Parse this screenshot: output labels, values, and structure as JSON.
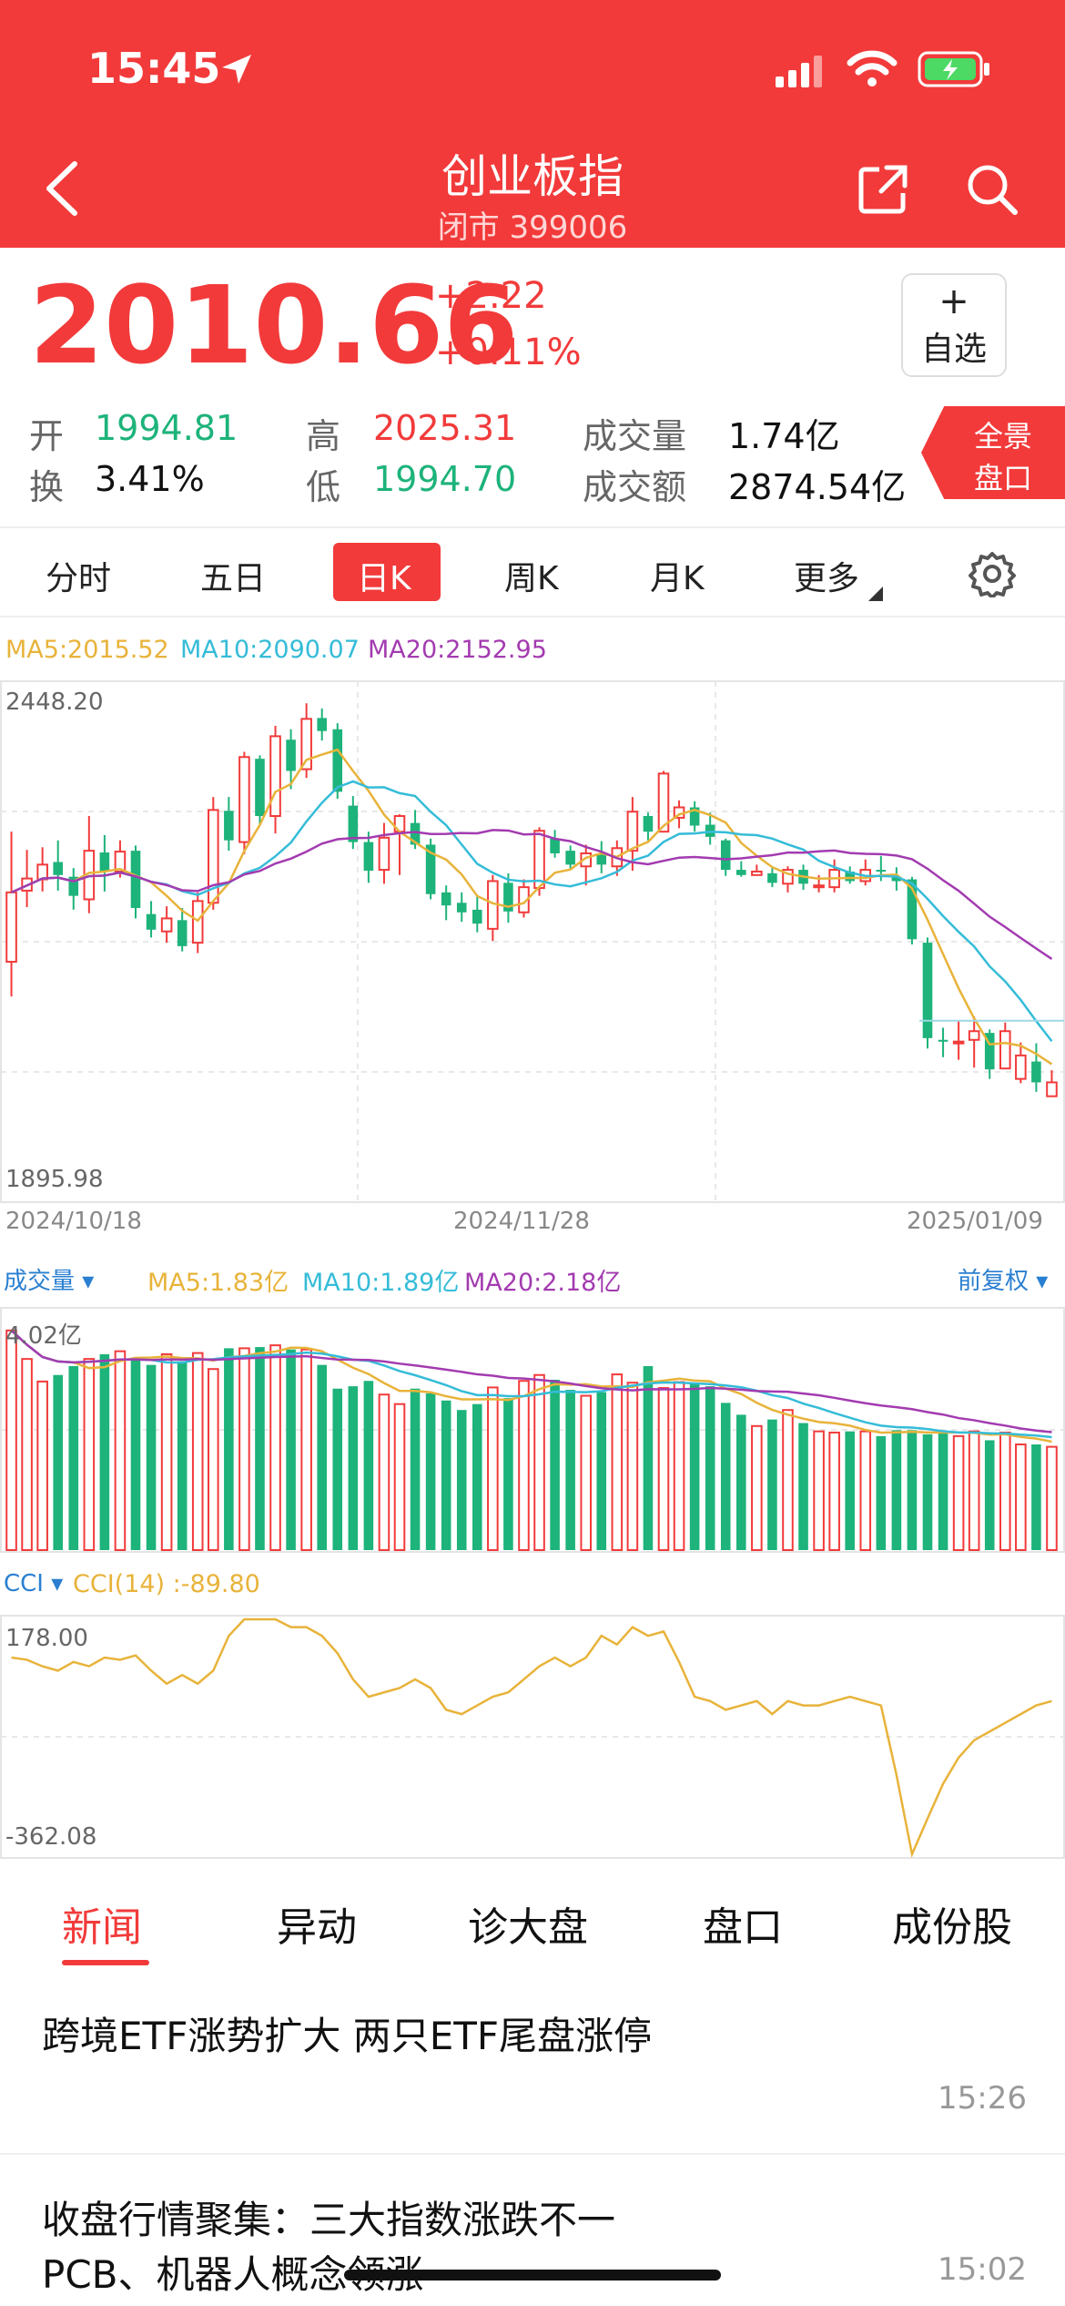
{
  "status_bar": {
    "time": "15:45"
  },
  "header": {
    "title": "创业板指",
    "subtitle": "闭市 399006"
  },
  "quote": {
    "price": "2010.66",
    "change": "+2.22",
    "change_pct": "+0.11%",
    "add_watch_plus": "+",
    "add_watch_label": "自选",
    "open_label": "开",
    "open": "1994.81",
    "high_label": "高",
    "high": "2025.31",
    "turnover_label": "换",
    "turnover": "3.41%",
    "low_label": "低",
    "low": "1994.70",
    "volume_label": "成交量",
    "volume": "1.74亿",
    "amount_label": "成交额",
    "amount": "2874.54亿",
    "panorama_line1": "全景",
    "panorama_line2": "盘口"
  },
  "period_tabs": {
    "items": [
      "分时",
      "五日",
      "日K",
      "周K",
      "月K",
      "更多"
    ],
    "active": 2
  },
  "kline": {
    "ma5": "MA5:2015.52",
    "ma10": "MA10:2090.07",
    "ma20": "MA20:2152.95",
    "y_max_label": "2448.20",
    "y_min_label": "1895.98",
    "date_start": "2024/10/18",
    "date_mid": "2024/11/28",
    "date_end": "2025/01/09"
  },
  "volume_panel": {
    "label": "成交量",
    "ma5": "MA5:1.83亿",
    "ma10": "MA10:1.89亿",
    "ma20": "MA20:2.18亿",
    "adjust_label": "前复权",
    "y_max_label": "4.02亿"
  },
  "cci_panel": {
    "label": "CCI",
    "value": "CCI(14) :-89.80",
    "y_max_label": "178.00",
    "y_min_label": "-362.08"
  },
  "news_tabs": {
    "items": [
      "新闻",
      "异动",
      "诊大盘",
      "盘口",
      "成份股"
    ],
    "active": 0
  },
  "news": [
    {
      "title": "跨境ETF涨势扩大 两只ETF尾盘涨停",
      "time": "15:26"
    },
    {
      "title": "收盘行情聚集：三大指数涨跌不一 PCB、机器人概念领涨",
      "time": "15:02"
    }
  ],
  "colors": {
    "brand": "#f23a3a",
    "up": "#f23a3a",
    "down": "#1db37a",
    "ma5": "#e8b33a",
    "ma10": "#35bcd8",
    "ma20": "#a33bb0"
  },
  "chart_data": [
    {
      "type": "candlestick",
      "title": "日K",
      "ylim": [
        1895.98,
        2448.2
      ],
      "x_tick_labels": [
        "2024/10/18",
        "2024/11/28",
        "2025/01/09"
      ],
      "candles": [
        [
          2150,
          2230,
          2300,
          2110
        ],
        [
          2232,
          2246,
          2279,
          2213
        ],
        [
          2245,
          2262,
          2282,
          2231
        ],
        [
          2265,
          2250,
          2290,
          2232
        ],
        [
          2248,
          2226,
          2258,
          2210
        ],
        [
          2222,
          2278,
          2318,
          2206
        ],
        [
          2276,
          2254,
          2296,
          2231
        ],
        [
          2254,
          2277,
          2290,
          2247
        ],
        [
          2278,
          2212,
          2284,
          2200
        ],
        [
          2205,
          2187,
          2220,
          2178
        ],
        [
          2185,
          2200,
          2214,
          2172
        ],
        [
          2198,
          2168,
          2212,
          2162
        ],
        [
          2172,
          2220,
          2230,
          2160
        ],
        [
          2218,
          2325,
          2340,
          2210
        ],
        [
          2324,
          2290,
          2340,
          2278
        ],
        [
          2288,
          2386,
          2392,
          2274
        ],
        [
          2384,
          2318,
          2388,
          2308
        ],
        [
          2318,
          2410,
          2422,
          2298
        ],
        [
          2406,
          2370,
          2418,
          2349
        ],
        [
          2372,
          2430,
          2448,
          2362
        ],
        [
          2431,
          2416,
          2442,
          2405
        ],
        [
          2418,
          2346,
          2425,
          2338
        ],
        [
          2330,
          2288,
          2341,
          2280
        ],
        [
          2288,
          2255,
          2300,
          2241
        ],
        [
          2256,
          2293,
          2310,
          2240
        ],
        [
          2300,
          2318,
          2320,
          2250
        ],
        [
          2310,
          2285,
          2325,
          2280
        ],
        [
          2285,
          2228,
          2292,
          2222
        ],
        [
          2230,
          2215,
          2238,
          2198
        ],
        [
          2218,
          2207,
          2230,
          2196
        ],
        [
          2210,
          2194,
          2225,
          2184
        ],
        [
          2188,
          2243,
          2250,
          2174
        ],
        [
          2241,
          2208,
          2252,
          2195
        ],
        [
          2207,
          2236,
          2245,
          2201
        ],
        [
          2235,
          2301,
          2305,
          2226
        ],
        [
          2292,
          2275,
          2302,
          2270
        ],
        [
          2278,
          2262,
          2284,
          2256
        ],
        [
          2260,
          2275,
          2285,
          2238
        ],
        [
          2275,
          2262,
          2289,
          2252
        ],
        [
          2260,
          2281,
          2290,
          2249
        ],
        [
          2278,
          2323,
          2340,
          2255
        ],
        [
          2318,
          2300,
          2322,
          2290
        ],
        [
          2300,
          2367,
          2370,
          2300
        ],
        [
          2316,
          2328,
          2336,
          2304
        ],
        [
          2328,
          2307,
          2335,
          2300
        ],
        [
          2308,
          2294,
          2322,
          2285
        ],
        [
          2290,
          2256,
          2292,
          2249
        ],
        [
          2256,
          2250,
          2266,
          2248
        ],
        [
          2250,
          2254,
          2262,
          2250
        ],
        [
          2252,
          2241,
          2258,
          2236
        ],
        [
          2240,
          2256,
          2260,
          2230
        ],
        [
          2256,
          2240,
          2262,
          2233
        ],
        [
          2238,
          2238,
          2250,
          2230
        ],
        [
          2236,
          2256,
          2268,
          2230
        ],
        [
          2254,
          2243,
          2260,
          2240
        ],
        [
          2243,
          2256,
          2268,
          2238
        ],
        [
          2256,
          2255,
          2272,
          2243
        ],
        [
          2248,
          2243,
          2259,
          2232
        ],
        [
          2245,
          2176,
          2248,
          2170
        ],
        [
          2172,
          2062,
          2178,
          2050
        ],
        [
          2060,
          2058,
          2074,
          2040
        ],
        [
          2058,
          2058,
          2082,
          2037
        ],
        [
          2060,
          2070,
          2087,
          2028
        ],
        [
          2068,
          2026,
          2072,
          2015
        ],
        [
          2027,
          2070,
          2080,
          2026
        ],
        [
          2015,
          2042,
          2057,
          2010
        ],
        [
          2035,
          2011,
          2056,
          2000
        ],
        [
          1995,
          2011,
          2025,
          1995
        ]
      ],
      "ma5_label": "MA5:2015.52",
      "ma10_label": "MA10:2090.07",
      "ma20_label": "MA20:2152.95"
    },
    {
      "type": "bar",
      "title": "成交量",
      "ylim": [
        0,
        4.02
      ],
      "values": [
        3.7,
        3.22,
        2.84,
        2.95,
        3.1,
        3.22,
        3.3,
        3.35,
        3.23,
        3.12,
        3.3,
        3.18,
        3.32,
        3.05,
        3.4,
        3.4,
        3.42,
        3.45,
        3.38,
        3.38,
        3.12,
        2.72,
        2.76,
        2.85,
        2.62,
        2.46,
        2.72,
        2.64,
        2.52,
        2.36,
        2.46,
        2.74,
        2.56,
        2.85,
        2.95,
        2.87,
        2.7,
        2.6,
        2.66,
        2.96,
        2.82,
        3.1,
        2.73,
        2.83,
        2.8,
        2.76,
        2.48,
        2.28,
        2.09,
        2.2,
        2.36,
        2.14,
        2.0,
        1.98,
        2.0,
        2.0,
        1.92,
        2.02,
        2.02,
        1.95,
        2.0,
        1.92,
        2.0,
        1.85,
        1.98,
        1.78,
        1.78,
        1.74
      ],
      "ma5_label": "MA5:1.83亿",
      "ma10_label": "MA10:1.89亿",
      "ma20_label": "MA20:2.18亿"
    },
    {
      "type": "line",
      "title": "CCI(14)",
      "ylim": [
        -362.08,
        178.0
      ],
      "series": [
        {
          "name": "CCI(14)",
          "values": [
            90,
            85,
            70,
            60,
            80,
            70,
            90,
            85,
            95,
            60,
            30,
            50,
            30,
            60,
            140,
            178,
            178,
            178,
            160,
            160,
            140,
            100,
            40,
            0,
            10,
            20,
            40,
            20,
            -30,
            -40,
            -20,
            0,
            10,
            40,
            70,
            90,
            70,
            90,
            140,
            120,
            160,
            140,
            150,
            80,
            0,
            -10,
            -30,
            -20,
            -10,
            -40,
            -10,
            -20,
            -20,
            -10,
            0,
            -10,
            -20,
            -180,
            -362,
            -280,
            -200,
            -140,
            -100,
            -80,
            -60,
            -40,
            -20,
            -10
          ]
        }
      ]
    }
  ]
}
